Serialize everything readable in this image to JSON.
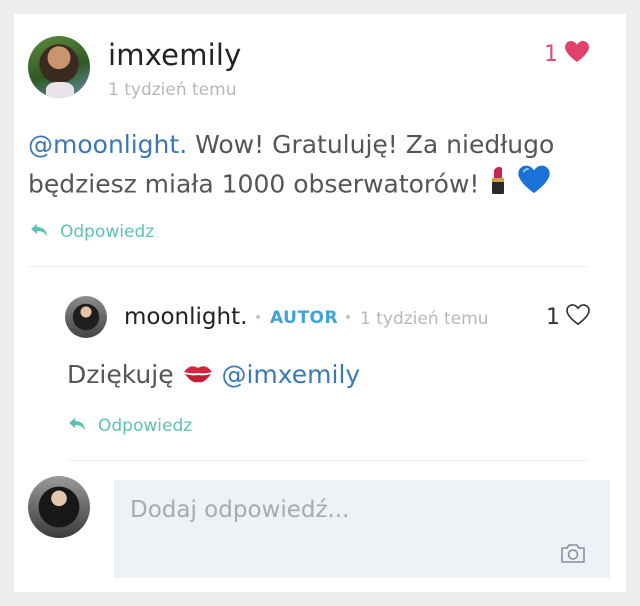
{
  "comment": {
    "username": "imxemily",
    "time": "1 tydzień temu",
    "likes": "1",
    "mention": "@moonlight.",
    "text_line1": " Wow! Gratuluję! Za niedługo",
    "text_line2": "będziesz miała 1000 obserwatorów! ",
    "reply_label": "Odpowiedz"
  },
  "reply": {
    "username": "moonlight.",
    "badge": "AUTOR",
    "time": "1 tydzień temu",
    "likes": "1",
    "text": "Dziękuję ",
    "mention": " @imxemily",
    "reply_label": "Odpowiedz"
  },
  "composer": {
    "placeholder": "Dodaj odpowiedź..."
  },
  "icons": {
    "like_filled": "heart-filled-icon",
    "like_outline": "heart-outline-icon",
    "reply": "reply-arrow-icon",
    "camera": "camera-icon",
    "lipstick": "lipstick-emoji",
    "blue_heart": "blue-heart-emoji",
    "kiss": "kiss-mark-emoji"
  },
  "colors": {
    "accent_teal": "#5cc3b4",
    "mention_blue": "#3a79b8",
    "author_badge": "#3fa2d8",
    "like_red": "#e04a6a"
  }
}
